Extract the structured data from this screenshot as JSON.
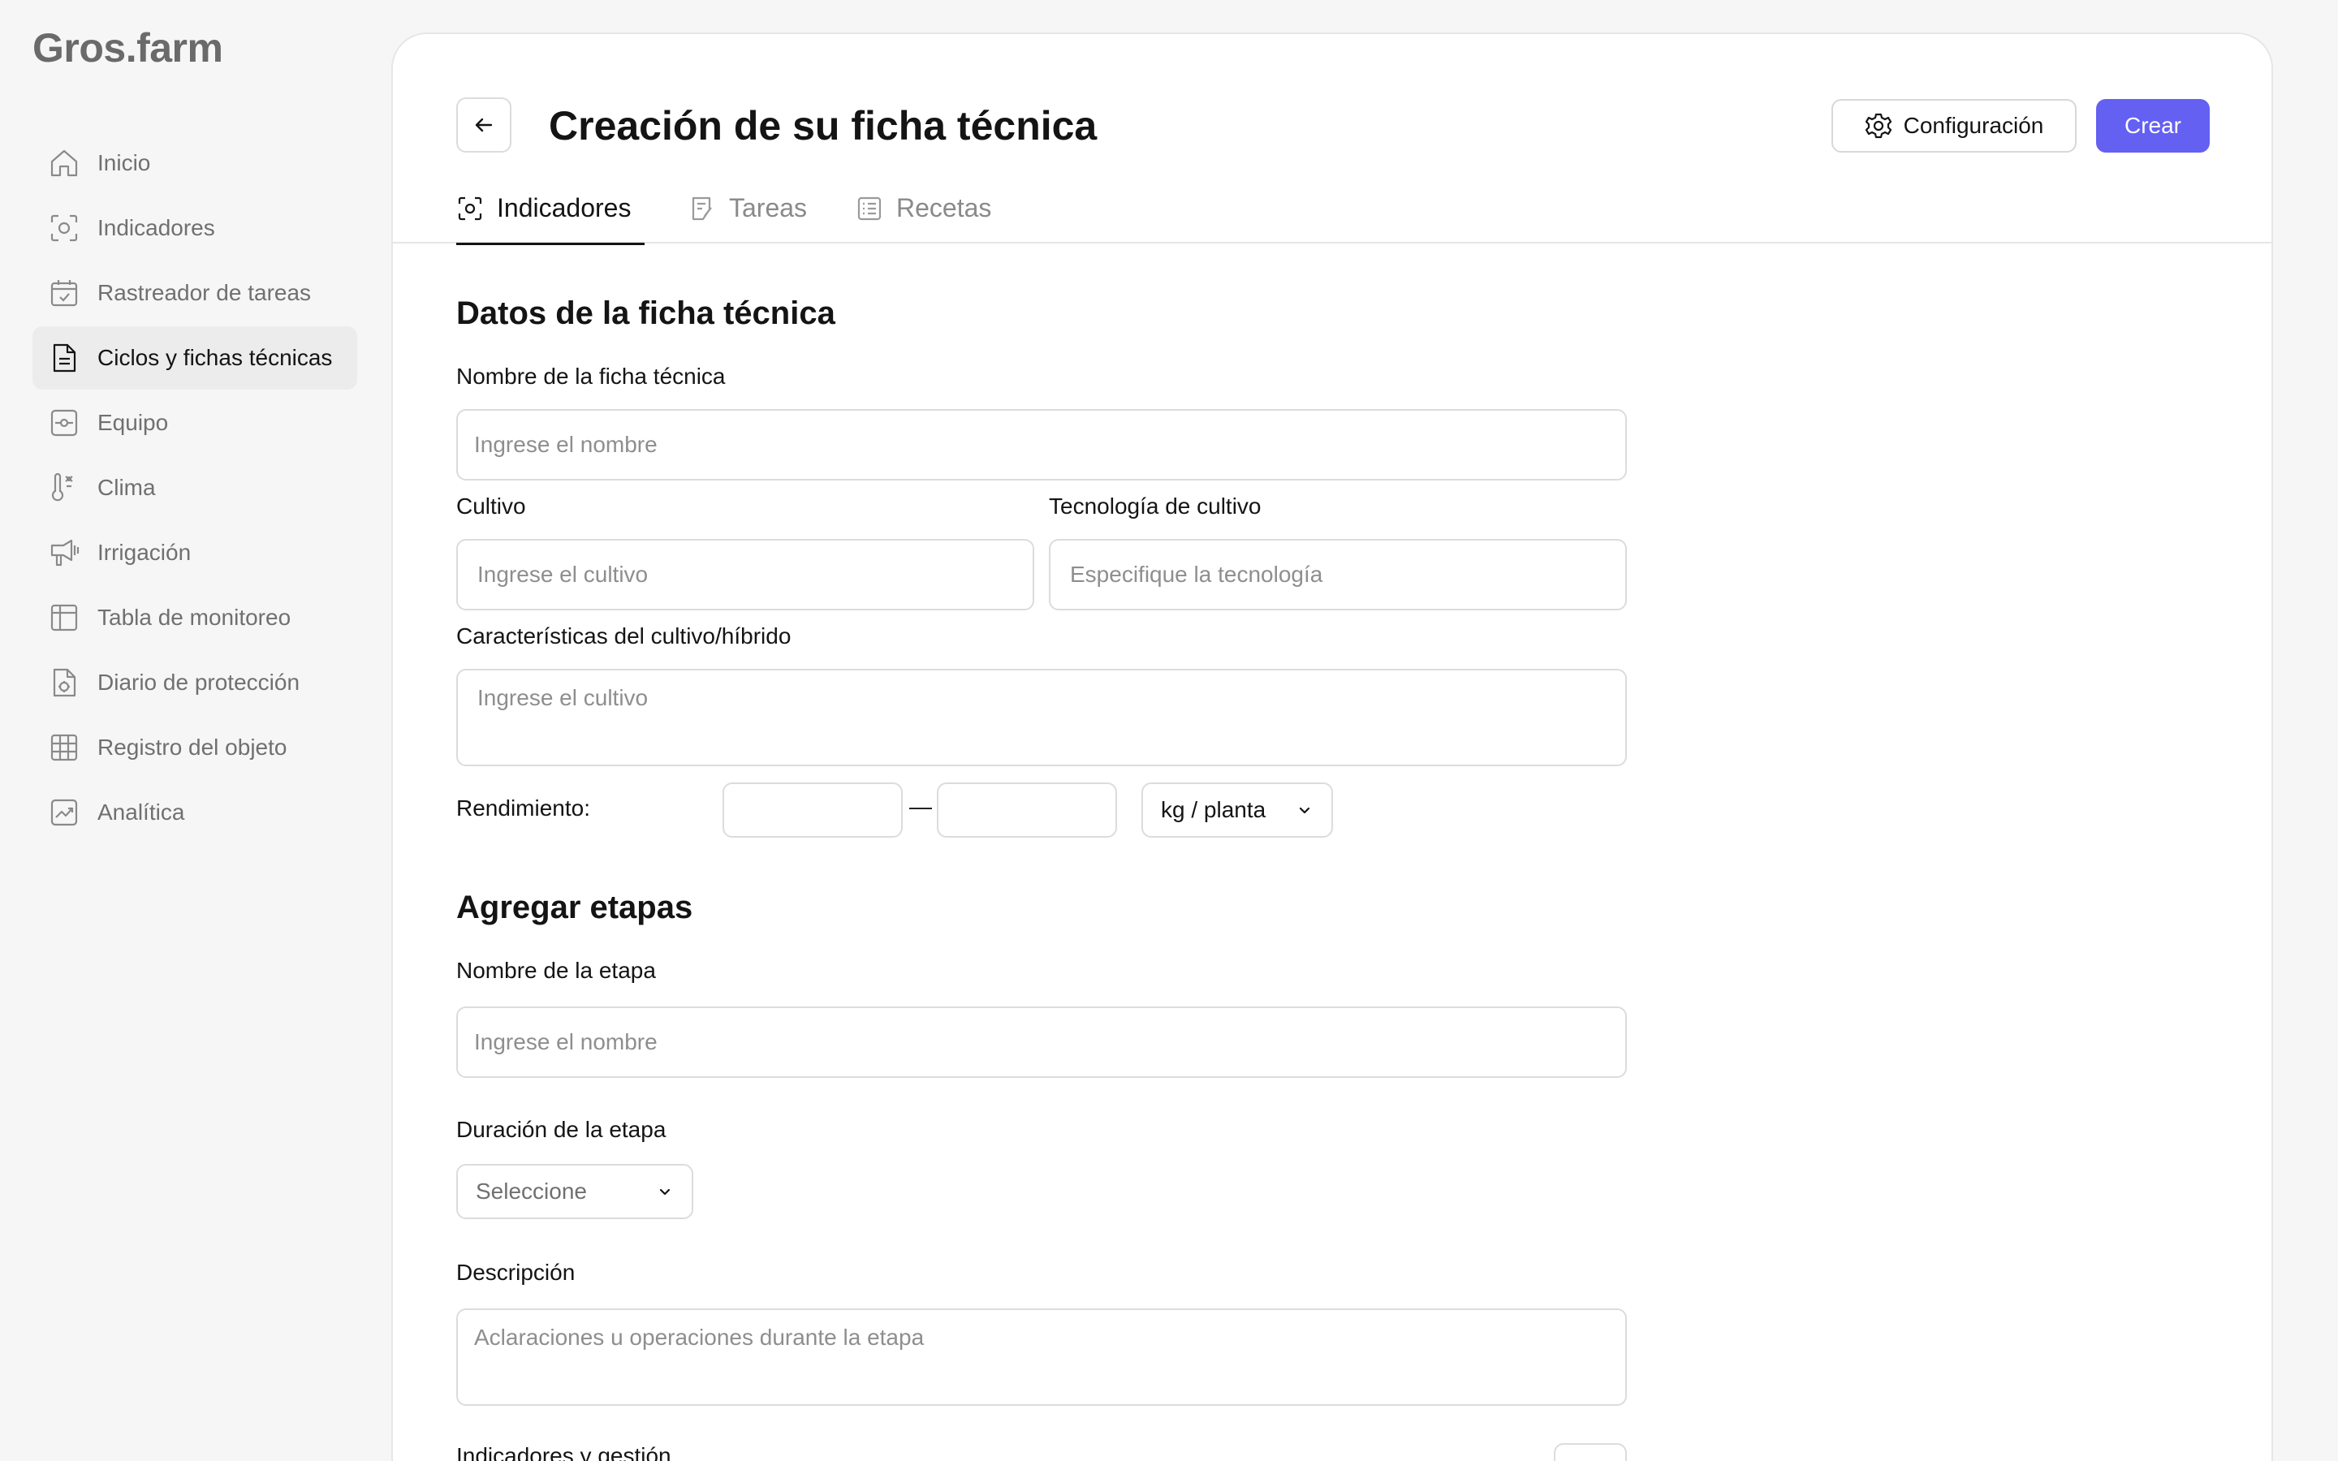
{
  "brand": {
    "logo_text": "Gros.farm"
  },
  "sidebar": {
    "items": [
      {
        "label": "Inicio",
        "icon": "home-icon"
      },
      {
        "label": "Indicadores",
        "icon": "indicators-icon"
      },
      {
        "label": "Rastreador de tareas",
        "icon": "calendar-check-icon"
      },
      {
        "label": "Ciclos y fichas técnicas",
        "icon": "document-icon",
        "active": true
      },
      {
        "label": "Equipo",
        "icon": "equipment-icon"
      },
      {
        "label": "Clima",
        "icon": "thermometer-icon"
      },
      {
        "label": "Irrigación",
        "icon": "irrigation-icon"
      },
      {
        "label": "Tabla de monitoreo",
        "icon": "table-icon"
      },
      {
        "label": "Diario de protección",
        "icon": "protection-diary-icon"
      },
      {
        "label": "Registro del objeto",
        "icon": "grid-icon"
      },
      {
        "label": "Analítica",
        "icon": "analytics-icon"
      }
    ]
  },
  "header": {
    "title": "Creación de su ficha técnica",
    "config_label": "Configuración",
    "create_label": "Crear"
  },
  "tabs": [
    {
      "label": "Indicadores",
      "active": true
    },
    {
      "label": "Tareas",
      "active": false
    },
    {
      "label": "Recetas",
      "active": false
    }
  ],
  "form": {
    "section1_title": "Datos de la ficha técnica",
    "name_label": "Nombre de la ficha técnica",
    "name_placeholder": "Ingrese el nombre",
    "crop_label": "Cultivo",
    "crop_placeholder": "Ingrese el cultivo",
    "tech_label": "Tecnología de cultivo",
    "tech_placeholder": "Especifique la tecnología",
    "features_label": "Características del cultivo/híbrido",
    "features_placeholder": "Ingrese el cultivo",
    "yield_label": "Rendimiento:",
    "yield_min": "",
    "yield_max": "",
    "yield_separator": "—",
    "yield_unit": "kg / planta",
    "section2_title": "Agregar etapas",
    "stage_name_label": "Nombre de la etapa",
    "stage_name_placeholder": "Ingrese el nombre",
    "duration_label": "Duración de la etapa",
    "duration_value": "Seleccione",
    "description_label": "Descripción",
    "description_placeholder": "Aclaraciones u operaciones durante la etapa",
    "indicators_label": "Indicadores y gestión"
  },
  "colors": {
    "accent": "#6460f2",
    "active_nav_bg": "#ececec"
  }
}
